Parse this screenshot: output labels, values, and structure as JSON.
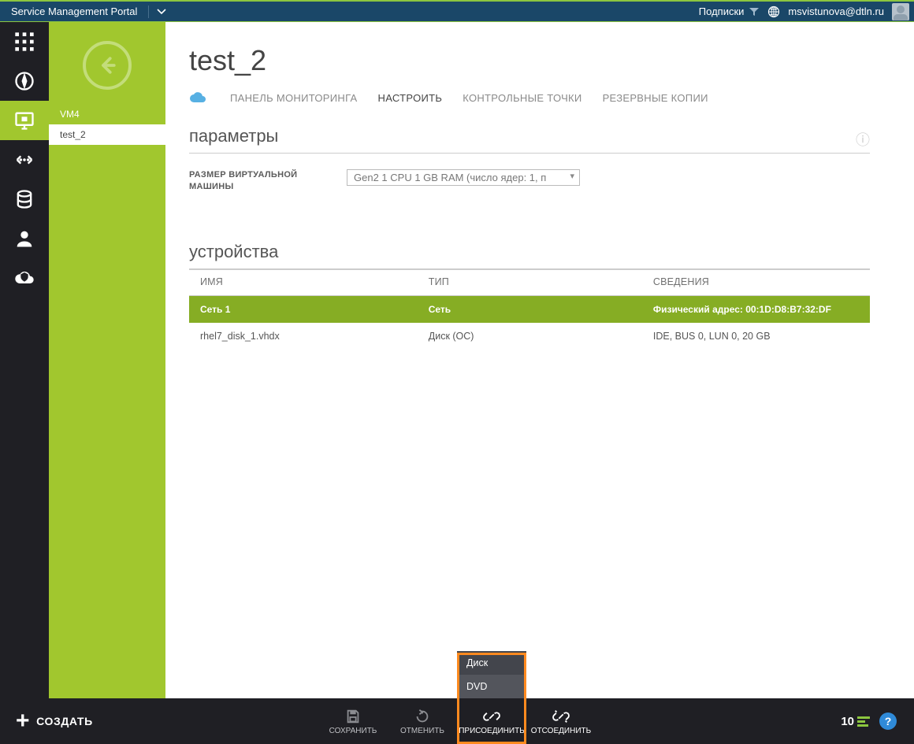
{
  "header": {
    "app_title": "Service Management Portal",
    "subscriptions_label": "Подписки",
    "user_email": "msvistunova@dtln.ru"
  },
  "subnav": {
    "items": [
      {
        "label": "VM4"
      },
      {
        "label": "test_2"
      }
    ],
    "active_index": 1
  },
  "page": {
    "title": "test_2",
    "tabs": [
      {
        "label": "ПАНЕЛЬ МОНИТОРИНГА"
      },
      {
        "label": "НАСТРОИТЬ"
      },
      {
        "label": "КОНТРОЛЬНЫЕ ТОЧКИ"
      },
      {
        "label": "РЕЗЕРВНЫЕ КОПИИ"
      }
    ],
    "active_tab": 1
  },
  "params": {
    "section_title": "параметры",
    "vm_size_label": "РАЗМЕР ВИРТУАЛЬНОЙ МАШИНЫ",
    "vm_size_value": "Gen2 1 CPU 1 GB RAM (число ядер: 1, п"
  },
  "devices": {
    "section_title": "устройства",
    "columns": {
      "name": "ИМЯ",
      "type": "ТИП",
      "details": "СВЕДЕНИЯ"
    },
    "rows": [
      {
        "name": "Сеть 1",
        "type": "Сеть",
        "details": "Физический адрес: 00:1D:D8:B7:32:DF",
        "selected": true
      },
      {
        "name": "rhel7_disk_1.vhdx",
        "type": "Диск (ОС)",
        "details": "IDE, BUS 0, LUN 0, 20 GB",
        "selected": false
      }
    ]
  },
  "bottombar": {
    "create_label": "СОЗДАТЬ",
    "save_label": "СОХРАНИТЬ",
    "discard_label": "ОТМЕНИТЬ",
    "attach_label": "ПРИСОЕДИНИТЬ",
    "detach_label": "ОТСОЕДИНИТЬ",
    "attach_menu": {
      "disk": "Диск",
      "dvd": "DVD"
    },
    "notification_count": "10",
    "help": "?"
  }
}
